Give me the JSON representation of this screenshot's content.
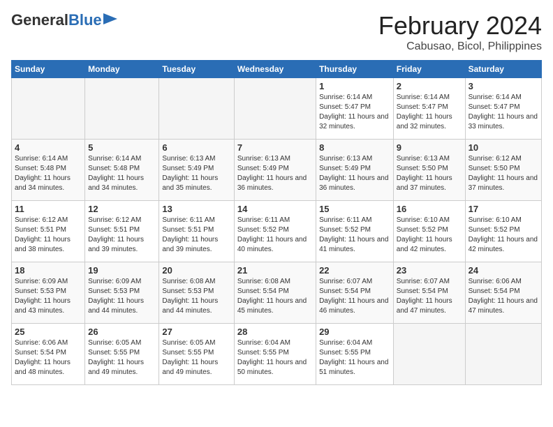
{
  "logo": {
    "text_general": "General",
    "text_blue": "Blue"
  },
  "title": "February 2024",
  "subtitle": "Cabusao, Bicol, Philippines",
  "days_of_week": [
    "Sunday",
    "Monday",
    "Tuesday",
    "Wednesday",
    "Thursday",
    "Friday",
    "Saturday"
  ],
  "weeks": [
    [
      {
        "day": "",
        "info": ""
      },
      {
        "day": "",
        "info": ""
      },
      {
        "day": "",
        "info": ""
      },
      {
        "day": "",
        "info": ""
      },
      {
        "day": "1",
        "sunrise": "6:14 AM",
        "sunset": "5:47 PM",
        "daylight": "11 hours and 32 minutes."
      },
      {
        "day": "2",
        "sunrise": "6:14 AM",
        "sunset": "5:47 PM",
        "daylight": "11 hours and 32 minutes."
      },
      {
        "day": "3",
        "sunrise": "6:14 AM",
        "sunset": "5:47 PM",
        "daylight": "11 hours and 33 minutes."
      }
    ],
    [
      {
        "day": "4",
        "sunrise": "6:14 AM",
        "sunset": "5:48 PM",
        "daylight": "11 hours and 34 minutes."
      },
      {
        "day": "5",
        "sunrise": "6:14 AM",
        "sunset": "5:48 PM",
        "daylight": "11 hours and 34 minutes."
      },
      {
        "day": "6",
        "sunrise": "6:13 AM",
        "sunset": "5:49 PM",
        "daylight": "11 hours and 35 minutes."
      },
      {
        "day": "7",
        "sunrise": "6:13 AM",
        "sunset": "5:49 PM",
        "daylight": "11 hours and 36 minutes."
      },
      {
        "day": "8",
        "sunrise": "6:13 AM",
        "sunset": "5:49 PM",
        "daylight": "11 hours and 36 minutes."
      },
      {
        "day": "9",
        "sunrise": "6:13 AM",
        "sunset": "5:50 PM",
        "daylight": "11 hours and 37 minutes."
      },
      {
        "day": "10",
        "sunrise": "6:12 AM",
        "sunset": "5:50 PM",
        "daylight": "11 hours and 37 minutes."
      }
    ],
    [
      {
        "day": "11",
        "sunrise": "6:12 AM",
        "sunset": "5:51 PM",
        "daylight": "11 hours and 38 minutes."
      },
      {
        "day": "12",
        "sunrise": "6:12 AM",
        "sunset": "5:51 PM",
        "daylight": "11 hours and 39 minutes."
      },
      {
        "day": "13",
        "sunrise": "6:11 AM",
        "sunset": "5:51 PM",
        "daylight": "11 hours and 39 minutes."
      },
      {
        "day": "14",
        "sunrise": "6:11 AM",
        "sunset": "5:52 PM",
        "daylight": "11 hours and 40 minutes."
      },
      {
        "day": "15",
        "sunrise": "6:11 AM",
        "sunset": "5:52 PM",
        "daylight": "11 hours and 41 minutes."
      },
      {
        "day": "16",
        "sunrise": "6:10 AM",
        "sunset": "5:52 PM",
        "daylight": "11 hours and 42 minutes."
      },
      {
        "day": "17",
        "sunrise": "6:10 AM",
        "sunset": "5:52 PM",
        "daylight": "11 hours and 42 minutes."
      }
    ],
    [
      {
        "day": "18",
        "sunrise": "6:09 AM",
        "sunset": "5:53 PM",
        "daylight": "11 hours and 43 minutes."
      },
      {
        "day": "19",
        "sunrise": "6:09 AM",
        "sunset": "5:53 PM",
        "daylight": "11 hours and 44 minutes."
      },
      {
        "day": "20",
        "sunrise": "6:08 AM",
        "sunset": "5:53 PM",
        "daylight": "11 hours and 44 minutes."
      },
      {
        "day": "21",
        "sunrise": "6:08 AM",
        "sunset": "5:54 PM",
        "daylight": "11 hours and 45 minutes."
      },
      {
        "day": "22",
        "sunrise": "6:07 AM",
        "sunset": "5:54 PM",
        "daylight": "11 hours and 46 minutes."
      },
      {
        "day": "23",
        "sunrise": "6:07 AM",
        "sunset": "5:54 PM",
        "daylight": "11 hours and 47 minutes."
      },
      {
        "day": "24",
        "sunrise": "6:06 AM",
        "sunset": "5:54 PM",
        "daylight": "11 hours and 47 minutes."
      }
    ],
    [
      {
        "day": "25",
        "sunrise": "6:06 AM",
        "sunset": "5:54 PM",
        "daylight": "11 hours and 48 minutes."
      },
      {
        "day": "26",
        "sunrise": "6:05 AM",
        "sunset": "5:55 PM",
        "daylight": "11 hours and 49 minutes."
      },
      {
        "day": "27",
        "sunrise": "6:05 AM",
        "sunset": "5:55 PM",
        "daylight": "11 hours and 49 minutes."
      },
      {
        "day": "28",
        "sunrise": "6:04 AM",
        "sunset": "5:55 PM",
        "daylight": "11 hours and 50 minutes."
      },
      {
        "day": "29",
        "sunrise": "6:04 AM",
        "sunset": "5:55 PM",
        "daylight": "11 hours and 51 minutes."
      },
      {
        "day": "",
        "info": ""
      },
      {
        "day": "",
        "info": ""
      }
    ]
  ],
  "labels": {
    "sunrise": "Sunrise:",
    "sunset": "Sunset:",
    "daylight": "Daylight:"
  }
}
